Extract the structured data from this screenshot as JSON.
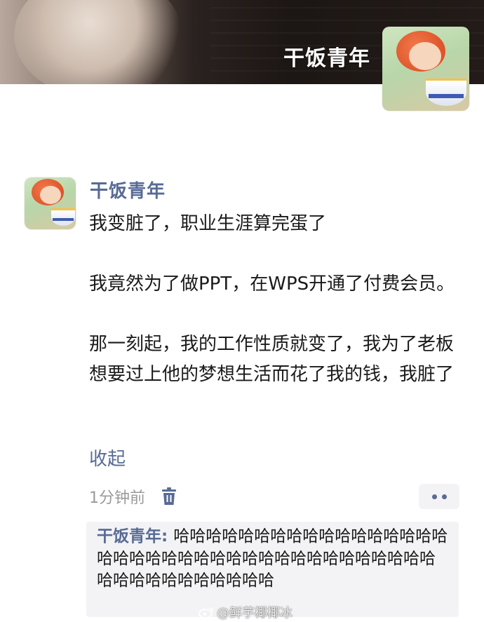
{
  "cover": {
    "username": "干饭青年"
  },
  "post": {
    "author": "干饭青年",
    "paragraphs": [
      "我变脏了，职业生涯算完蛋了",
      "我竟然为了做PPT，在WPS开通了付费会员。",
      "那一刻起，我的工作性质就变了，我为了老板想要过上他的梦想生活而花了我的钱，我脏了"
    ],
    "collapse_label": "收起",
    "timestamp": "1分钟前",
    "delete_icon": "trash-icon",
    "more_icon": "more-dots-icon"
  },
  "comment": {
    "author": "干饭青年",
    "separator": ": ",
    "text": "哈哈哈哈哈哈哈哈哈哈哈哈哈哈哈哈哈哈哈哈哈哈哈哈哈哈哈哈哈哈哈哈哈哈哈哈哈哈哈哈哈哈哈哈哈哈哈哈哈"
  },
  "watermark": {
    "text": "@鲜芋椰椰冰"
  },
  "colors": {
    "link_blue": "#576b95",
    "text": "#1a1a1a",
    "meta_gray": "#9a9a9a",
    "comment_bg": "#f3f3f5"
  }
}
